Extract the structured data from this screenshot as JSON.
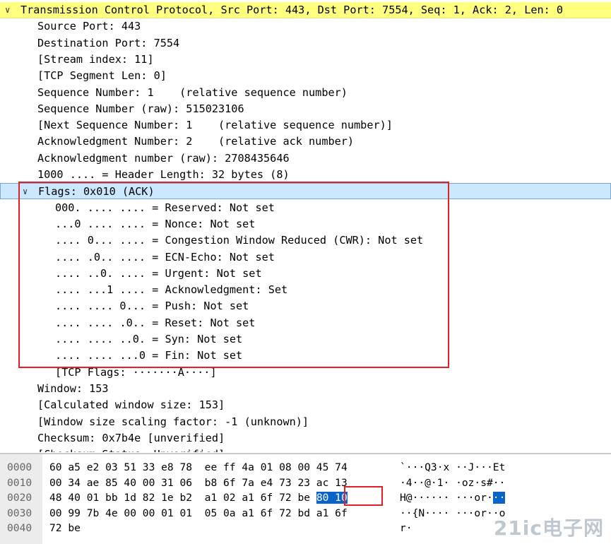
{
  "tree": {
    "rows": [
      {
        "text": "Transmission Control Protocol, Src Port: 443, Dst Port: 7554, Seq: 1, Ack: 2, Len: 0",
        "indent": 29,
        "expand": "open",
        "highlight": "yellow"
      },
      {
        "text": "Source Port: 443",
        "indent": 53
      },
      {
        "text": "Destination Port: 7554",
        "indent": 53
      },
      {
        "text": "[Stream index: 11]",
        "indent": 53
      },
      {
        "text": "[TCP Segment Len: 0]",
        "indent": 53
      },
      {
        "text": "Sequence Number: 1    (relative sequence number)",
        "indent": 53
      },
      {
        "text": "Sequence Number (raw): 515023106",
        "indent": 53
      },
      {
        "text": "[Next Sequence Number: 1    (relative sequence number)]",
        "indent": 53
      },
      {
        "text": "Acknowledgment Number: 2    (relative ack number)",
        "indent": 53
      },
      {
        "text": "Acknowledgment number (raw): 2708435646",
        "indent": 53
      },
      {
        "text": "1000 .... = Header Length: 32 bytes (8)",
        "indent": 53
      },
      {
        "text": "Flags: 0x010 (ACK)",
        "indent": 53,
        "expand": "open",
        "highlight": "blue"
      },
      {
        "text": "000. .... .... = Reserved: Not set",
        "indent": 78
      },
      {
        "text": "...0 .... .... = Nonce: Not set",
        "indent": 78
      },
      {
        "text": ".... 0... .... = Congestion Window Reduced (CWR): Not set",
        "indent": 78
      },
      {
        "text": ".... .0.. .... = ECN-Echo: Not set",
        "indent": 78
      },
      {
        "text": ".... ..0. .... = Urgent: Not set",
        "indent": 78
      },
      {
        "text": ".... ...1 .... = Acknowledgment: Set",
        "indent": 78
      },
      {
        "text": ".... .... 0... = Push: Not set",
        "indent": 78
      },
      {
        "text": ".... .... .0.. = Reset: Not set",
        "indent": 78
      },
      {
        "text": ".... .... ..0. = Syn: Not set",
        "indent": 78
      },
      {
        "text": ".... .... ...0 = Fin: Not set",
        "indent": 78
      },
      {
        "text": "[TCP Flags: ·······A····]",
        "indent": 78
      },
      {
        "text": "Window: 153",
        "indent": 53
      },
      {
        "text": "[Calculated window size: 153]",
        "indent": 53
      },
      {
        "text": "[Window size scaling factor: -1 (unknown)]",
        "indent": 53
      },
      {
        "text": "Checksum: 0x7b4e [unverified]",
        "indent": 53
      },
      {
        "text": "[Checksum Status: Unverified]",
        "indent": 53
      }
    ]
  },
  "hex": {
    "rows": [
      {
        "offset": "0000",
        "bytes": "60 a5 e2 03 51 33 e8 78  ee ff 4a 01 08 00 45 74",
        "ascii": "`···Q3·x ··J···Et"
      },
      {
        "offset": "0010",
        "bytes": "00 34 ae 85 40 00 31 06  b8 6f 7a e4 73 23 ac 13",
        "ascii": "·4··@·1· ·oz·s#··"
      },
      {
        "offset": "0020",
        "bytes_pre": "48 40 01 bb 1d 82 1e b2  a1 02 a1 6f 72 be ",
        "bytes_sel": "80 10",
        "ascii_pre": "H@······ ···or·",
        "ascii_sel": "··"
      },
      {
        "offset": "0030",
        "bytes": "00 99 7b 4e 00 00 01 01  05 0a a1 6f 72 bd a1 6f",
        "ascii": "··{N···· ···or··o"
      },
      {
        "offset": "0040",
        "bytes": "72 be",
        "ascii": "r·"
      }
    ]
  },
  "colors": {
    "proto_highlight": "#ffff80",
    "flags_highlight": "#cce8ff",
    "annotation_box": "#e0202a",
    "selected_bytes": "#0a64c8"
  },
  "watermark": "21ic电子网"
}
